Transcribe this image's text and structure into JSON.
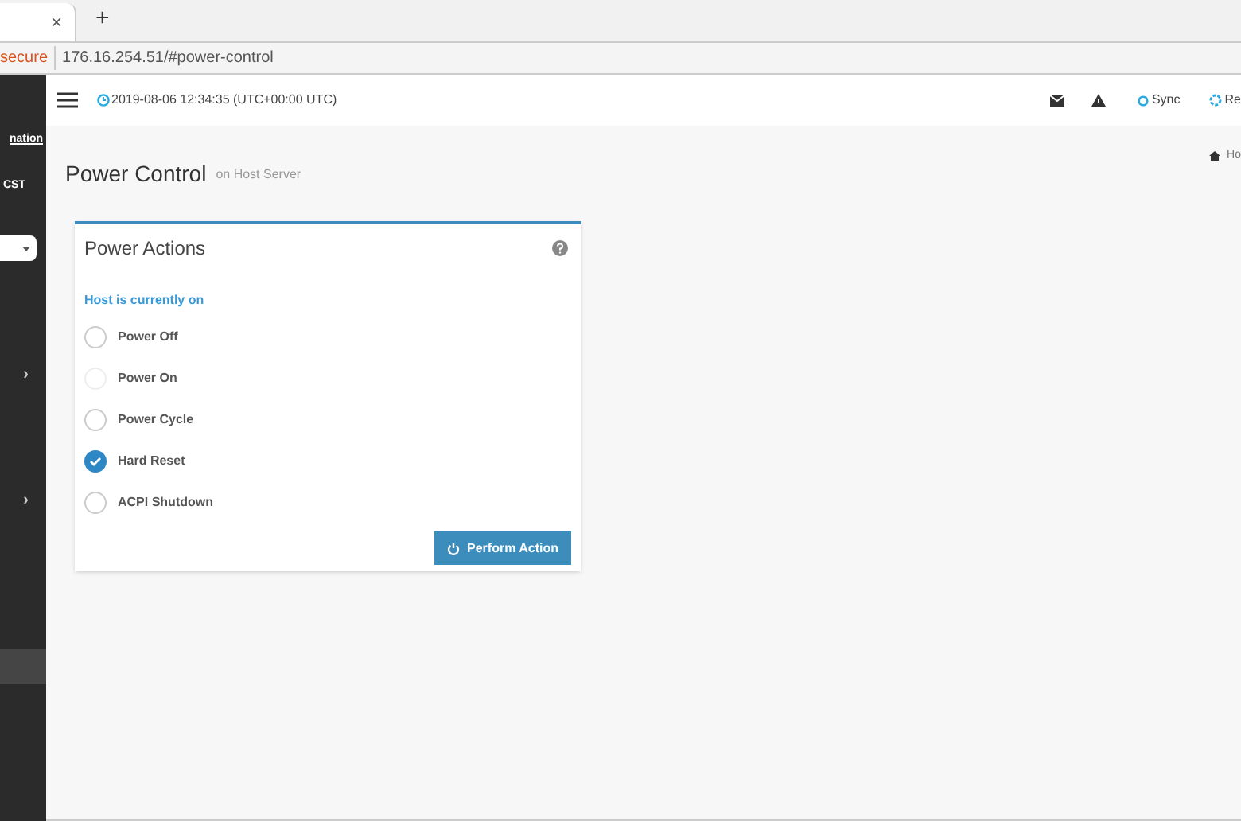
{
  "browser": {
    "tab_close": "×",
    "new_tab": "+",
    "security": "secure",
    "url": "176.16.254.51/#power-control"
  },
  "sidebar": {
    "items": [
      {
        "kind": "link",
        "label": "nation"
      },
      {
        "kind": "text",
        "label": "CST"
      },
      {
        "kind": "dropdown"
      },
      {
        "kind": "expander",
        "label": "›"
      },
      {
        "kind": "expander",
        "label": "›"
      },
      {
        "kind": "highlight"
      }
    ]
  },
  "header": {
    "datetime": "2019-08-06 12:34:35 (UTC+00:00 UTC)",
    "sync": "Sync",
    "refresh": "Re"
  },
  "page": {
    "title": "Power Control",
    "subtitle": "on Host Server",
    "breadcrumb": "Ho"
  },
  "card": {
    "title": "Power Actions",
    "status": "Host is currently on",
    "options": [
      {
        "label": "Power Off",
        "selected": false,
        "disabled": false
      },
      {
        "label": "Power On",
        "selected": false,
        "disabled": true
      },
      {
        "label": "Power Cycle",
        "selected": false,
        "disabled": false
      },
      {
        "label": "Hard Reset",
        "selected": true,
        "disabled": false
      },
      {
        "label": "ACPI Shutdown",
        "selected": false,
        "disabled": false
      }
    ],
    "button": "Perform Action"
  }
}
